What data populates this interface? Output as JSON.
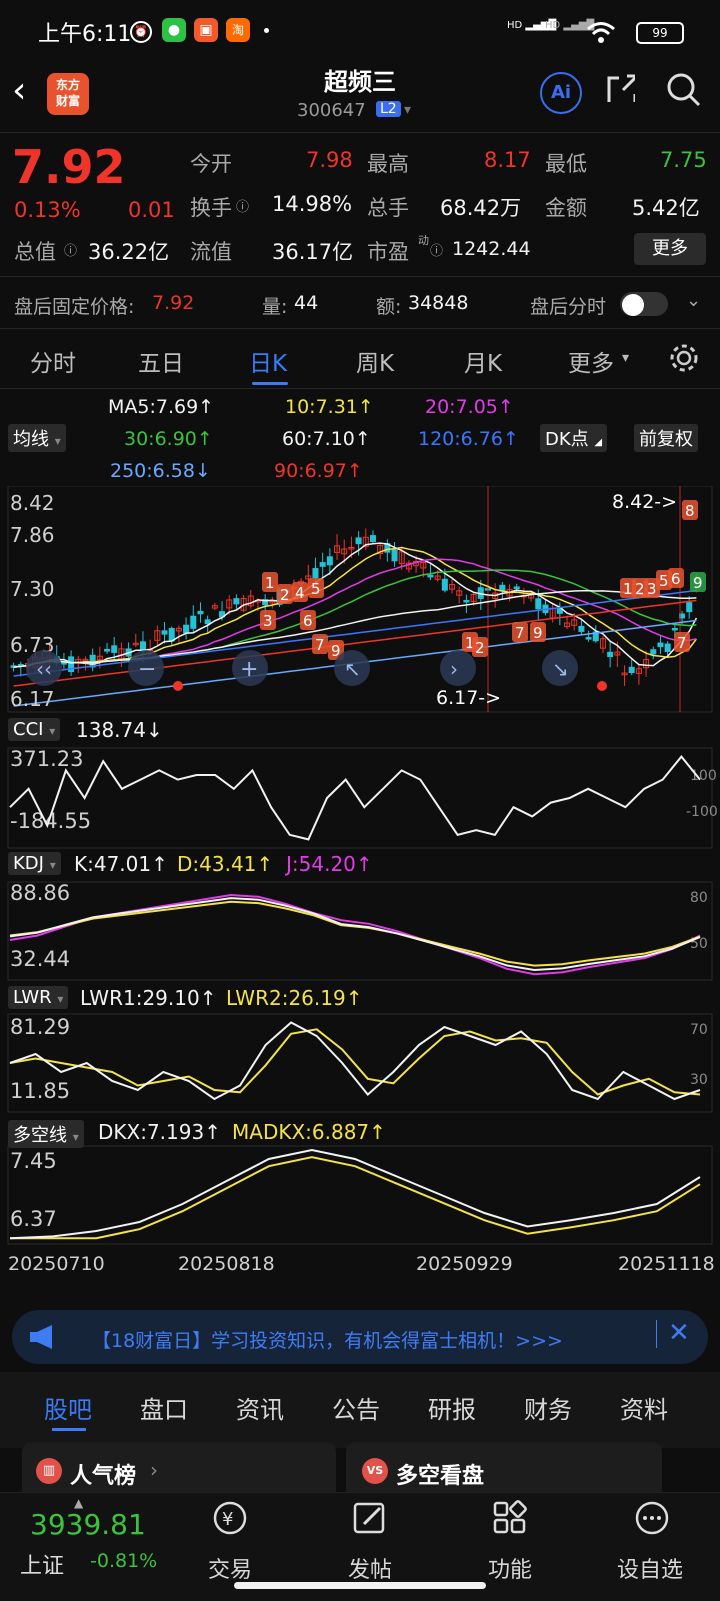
{
  "status_bar": {
    "time": "上午6:11",
    "battery": "99"
  },
  "header": {
    "logo_text": "东方\n财富",
    "title": "超频三",
    "code": "300647",
    "level": "L2"
  },
  "quote": {
    "price": "7.92",
    "change_pct": "0.13%",
    "change": "0.01",
    "open_label": "今开",
    "open": "7.98",
    "high_label": "最高",
    "high": "8.17",
    "low_label": "最低",
    "low": "7.75",
    "turnover_label": "换手",
    "turnover": "14.98%",
    "volume_label": "总手",
    "volume": "68.42万",
    "amount_label": "金额",
    "amount": "5.42亿",
    "mktcap_label": "总值",
    "mktcap": "36.22亿",
    "float_label": "流值",
    "float": "36.17亿",
    "pe_label": "市盈",
    "pe_sup": "动",
    "pe": "1242.44",
    "more": "更多"
  },
  "after_hours": {
    "price_label": "盘后固定价格:",
    "price": "7.92",
    "vol_label": "量:",
    "vol": "44",
    "amt_label": "额:",
    "amt": "34848",
    "toggle_label": "盘后分时"
  },
  "tabs": [
    "分时",
    "五日",
    "日K",
    "周K",
    "月K",
    "更多"
  ],
  "ma_selector": "均线",
  "ma": {
    "ma5": "MA5:7.69↑",
    "ma10": "10:7.31↑",
    "ma20": "20:7.05↑",
    "ma30": "30:6.90↑",
    "ma60": "60:7.10↑",
    "ma120": "120:6.76↑",
    "ma250": "250:6.58↓",
    "ma90": "90:6.97↑"
  },
  "dk_button": "DK点",
  "adjust_button": "前复权",
  "kline": {
    "y_ticks": [
      "8.42",
      "7.86",
      "7.30",
      "6.73",
      "6.17"
    ],
    "max_label": "8.42->",
    "min_label": "6.17->"
  },
  "cci": {
    "name": "CCI",
    "value": "138.74↓",
    "top": "371.23",
    "bottom": "-184.55",
    "ref_hi": "100",
    "ref_lo": "-100"
  },
  "kdj": {
    "name": "KDJ",
    "k": "K:47.01↑",
    "d": "D:43.41↑",
    "j": "J:54.20↑",
    "top": "88.86",
    "bottom": "32.44",
    "ref_hi": "80",
    "ref_lo": "50"
  },
  "lwr": {
    "name": "LWR",
    "lwr1": "LWR1:29.10↑",
    "lwr2": "LWR2:26.19↑",
    "top": "81.29",
    "bottom": "11.85",
    "ref_hi": "70",
    "ref_lo": "30"
  },
  "dkx": {
    "name": "多空线",
    "dkx": "DKX:7.193↑",
    "madkx": "MADKX:6.887↑",
    "top": "7.45",
    "bottom": "6.37"
  },
  "x_dates": [
    "20250710",
    "20250818",
    "20250929",
    "20251118"
  ],
  "banner": {
    "text": "【18财富日】学习投资知识，有机会得富士相机！>>>"
  },
  "bottom_tabs": [
    "股吧",
    "盘口",
    "资讯",
    "公告",
    "研报",
    "财务",
    "资料"
  ],
  "cards": {
    "left": "人气榜",
    "right": "多空看盘"
  },
  "index": {
    "value": "3939.81",
    "name": "上证",
    "change": "-0.81%"
  },
  "nav": [
    "交易",
    "发帖",
    "功能",
    "设自选"
  ],
  "colors": {
    "up": "#f0342a",
    "down": "#22c3d6",
    "accent": "#3a7bf7"
  }
}
